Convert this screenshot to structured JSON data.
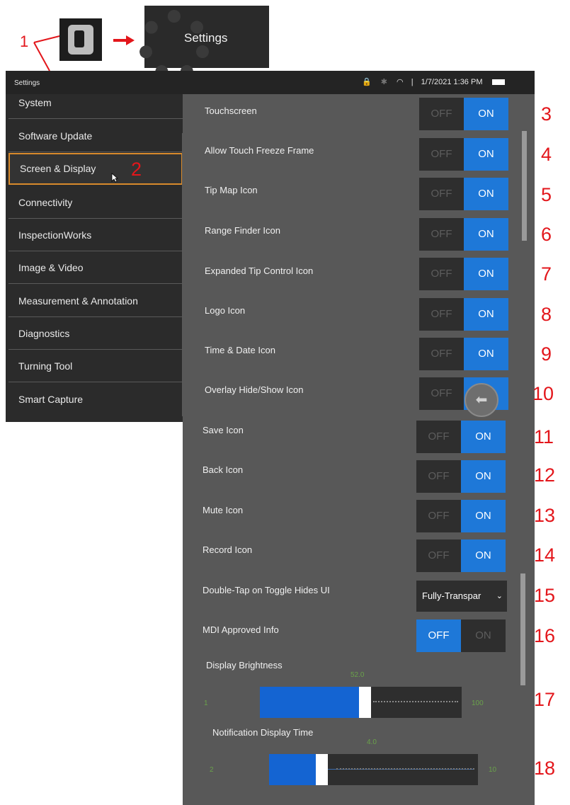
{
  "callouts": [
    "1",
    "2",
    "3",
    "4",
    "5",
    "6",
    "7",
    "8",
    "9",
    "10",
    "11",
    "12",
    "13",
    "14",
    "15",
    "16",
    "17",
    "18"
  ],
  "header": {
    "settings_tile_label": "Settings",
    "app_icon": "app-icon",
    "arrow_icon": "right-arrow-icon"
  },
  "statusbar": {
    "title": "Settings",
    "datetime": "1/7/2021 1:36 PM",
    "icons": [
      "lock-icon",
      "bluetooth-icon",
      "wifi-icon",
      "battery-icon"
    ]
  },
  "menu": {
    "items": [
      "System",
      "Software Update",
      "Screen & Display",
      "Connectivity",
      "InspectionWorks",
      "Image & Video",
      "Measurement & Annotation",
      "Diagnostics",
      "Turning Tool",
      "Smart Capture"
    ],
    "selected": "Screen & Display"
  },
  "settings": {
    "off_label": "OFF",
    "on_label": "ON",
    "rows": [
      {
        "label": "Touchscreen",
        "value": "ON"
      },
      {
        "label": "Allow Touch Freeze Frame",
        "value": "ON"
      },
      {
        "label": "Tip Map Icon",
        "value": "ON"
      },
      {
        "label": "Range Finder Icon",
        "value": "ON"
      },
      {
        "label": "Expanded Tip Control Icon",
        "value": "ON"
      },
      {
        "label": "Logo Icon",
        "value": "ON"
      },
      {
        "label": "Time & Date Icon",
        "value": "ON"
      },
      {
        "label": "Overlay Hide/Show Icon",
        "value": "ON"
      },
      {
        "label": "Save Icon",
        "value": "ON"
      },
      {
        "label": "Back Icon",
        "value": "ON"
      },
      {
        "label": "Mute Icon",
        "value": "ON"
      },
      {
        "label": "Record Icon",
        "value": "ON"
      }
    ],
    "double_tap": {
      "label": "Double-Tap on Toggle Hides UI",
      "value": "Fully-Transpar"
    },
    "mdi": {
      "label": "MDI Approved Info",
      "value": "OFF"
    },
    "brightness": {
      "label": "Display Brightness",
      "value": "52.0",
      "min": "1",
      "max": "100",
      "fraction": 0.52
    },
    "notification": {
      "label": "Notification Display Time",
      "value": "4.0",
      "min": "2",
      "max": "10",
      "fraction": 0.25
    }
  },
  "back_button_icon": "back-arrow-icon"
}
